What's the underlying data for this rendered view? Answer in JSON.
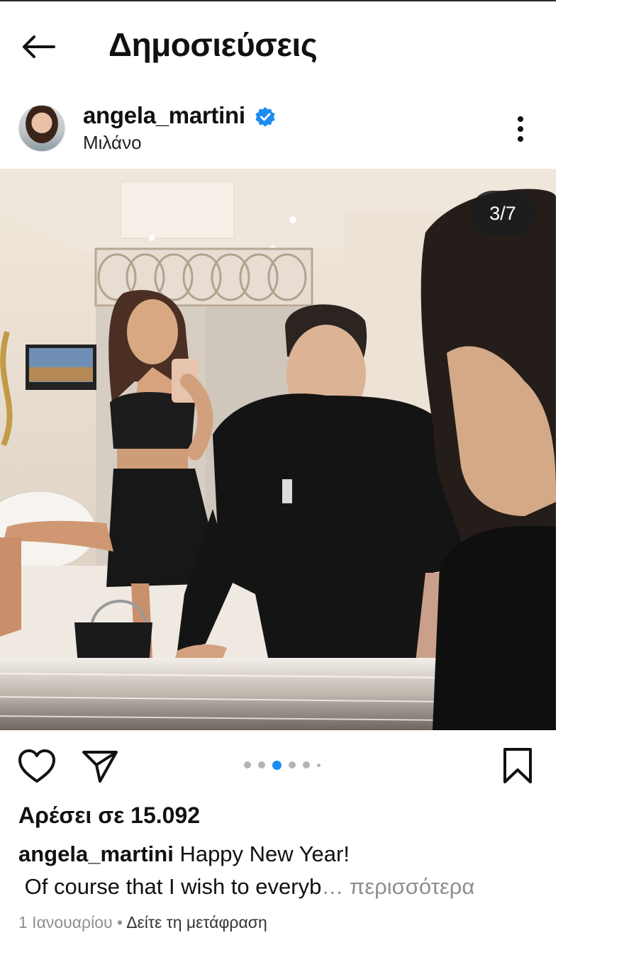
{
  "header": {
    "title": "Δημοσιεύσεις",
    "back_icon": "arrow-left-icon"
  },
  "post": {
    "username": "angela_martini",
    "verified": true,
    "location": "Μιλάνο",
    "more_icon": "more-vertical-icon",
    "carousel": {
      "position": "3/7",
      "current": 3,
      "total": 7
    },
    "photo_description_icon": "mirror-selfie-photo",
    "likes_text": "Αρέσει σε 15.092",
    "caption_user": "angela_martini",
    "caption_line1": "Happy New Year!",
    "caption_line2": "Of course that I wish to everyb",
    "ellipsis": "…",
    "more_label": "περισσότερα",
    "date": "1 Ιανουαρίου",
    "separator": "•",
    "translate_label": "Δείτε τη μετάφραση"
  },
  "actions": {
    "like_icon": "heart-icon",
    "share_icon": "paper-plane-icon",
    "save_icon": "bookmark-icon"
  },
  "colors": {
    "verified_blue": "#1d8cf0",
    "active_dot": "#1d8cf0",
    "muted": "#8e8e8e"
  }
}
